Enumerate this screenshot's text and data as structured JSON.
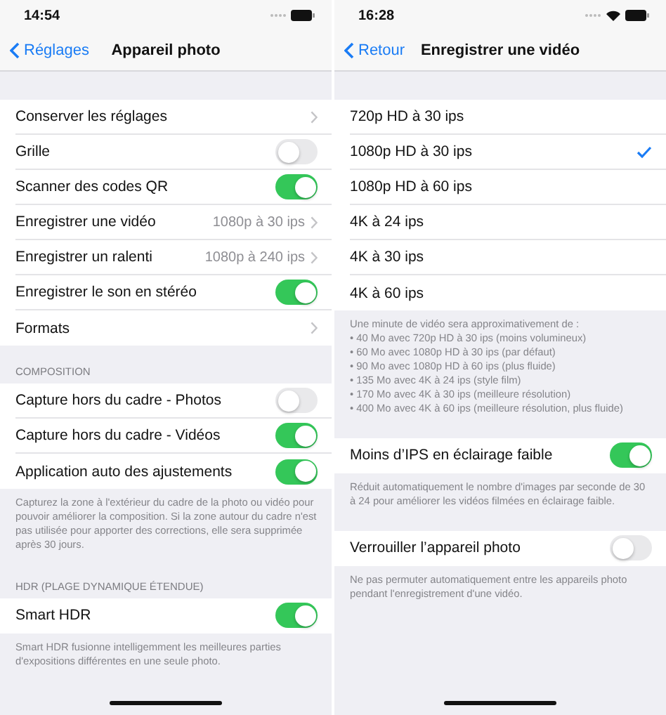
{
  "screens": [
    {
      "status_bar": {
        "time": "14:54",
        "wifi": false
      },
      "nav": {
        "back": "Réglages",
        "title": "Appareil photo"
      },
      "groups": [
        {
          "rows": [
            {
              "kind": "link",
              "label": "Conserver les réglages"
            },
            {
              "kind": "toggle",
              "label": "Grille",
              "on": false
            },
            {
              "kind": "toggle",
              "label": "Scanner des codes QR",
              "on": true
            },
            {
              "kind": "link",
              "label": "Enregistrer une vidéo",
              "value": "1080p à 30 ips"
            },
            {
              "kind": "link",
              "label": "Enregistrer un ralenti",
              "value": "1080p à 240 ips"
            },
            {
              "kind": "toggle",
              "label": "Enregistrer le son en stéréo",
              "on": true
            },
            {
              "kind": "link",
              "label": "Formats"
            }
          ]
        },
        {
          "header": "COMPOSITION",
          "rows": [
            {
              "kind": "toggle",
              "label": "Capture hors du cadre - Photos",
              "on": false
            },
            {
              "kind": "toggle",
              "label": "Capture hors du cadre - Vidéos",
              "on": true
            },
            {
              "kind": "toggle",
              "label": "Application auto des ajustements",
              "on": true
            }
          ],
          "footer": [
            "Capturez la zone à l'extérieur du cadre de la photo ou vidéo pour pouvoir améliorer la composition. Si la zone autour du cadre n'est pas utilisée pour apporter des corrections, elle sera supprimée après 30 jours."
          ]
        },
        {
          "header": "HDR (PLAGE DYNAMIQUE ÉTENDUE)",
          "rows": [
            {
              "kind": "toggle",
              "label": "Smart HDR",
              "on": true
            }
          ],
          "footer": [
            "Smart HDR fusionne intelligemment les meilleures parties d'expositions différentes en une seule photo."
          ]
        }
      ]
    },
    {
      "status_bar": {
        "time": "16:28",
        "wifi": true
      },
      "nav": {
        "back": "Retour",
        "title": "Enregistrer une vidéo"
      },
      "groups": [
        {
          "rows": [
            {
              "kind": "check",
              "label": "720p HD à 30 ips",
              "selected": false
            },
            {
              "kind": "check",
              "label": "1080p HD à 30 ips",
              "selected": true
            },
            {
              "kind": "check",
              "label": "1080p HD à 60 ips",
              "selected": false
            },
            {
              "kind": "check",
              "label": "4K à 24 ips",
              "selected": false
            },
            {
              "kind": "check",
              "label": "4K à 30 ips",
              "selected": false
            },
            {
              "kind": "check",
              "label": "4K à 60 ips",
              "selected": false
            }
          ],
          "footer": [
            "Une minute de vidéo sera approximativement de :",
            "• 40 Mo avec 720p HD à 30 ips (moins volumineux)",
            "• 60 Mo avec 1080p HD à 30 ips (par défaut)",
            "• 90 Mo avec 1080p HD à 60 ips (plus fluide)",
            "• 135 Mo avec 4K à 24 ips (style film)",
            "• 170 Mo avec 4K à 30 ips (meilleure résolution)",
            "• 400 Mo avec 4K à 60 ips (meilleure résolution, plus fluide)"
          ]
        },
        {
          "rows": [
            {
              "kind": "toggle",
              "label": "Moins d’IPS en éclairage faible",
              "on": true
            }
          ],
          "footer": [
            "Réduit automatiquement le nombre d'images par seconde de 30 à 24 pour améliorer les vidéos filmées en éclairage faible."
          ]
        },
        {
          "rows": [
            {
              "kind": "toggle",
              "label": "Verrouiller l’appareil photo",
              "on": false
            }
          ],
          "footer": [
            "Ne pas permuter automatiquement entre les appareils photo pendant l'enregistrement d'une vidéo."
          ]
        }
      ]
    }
  ]
}
